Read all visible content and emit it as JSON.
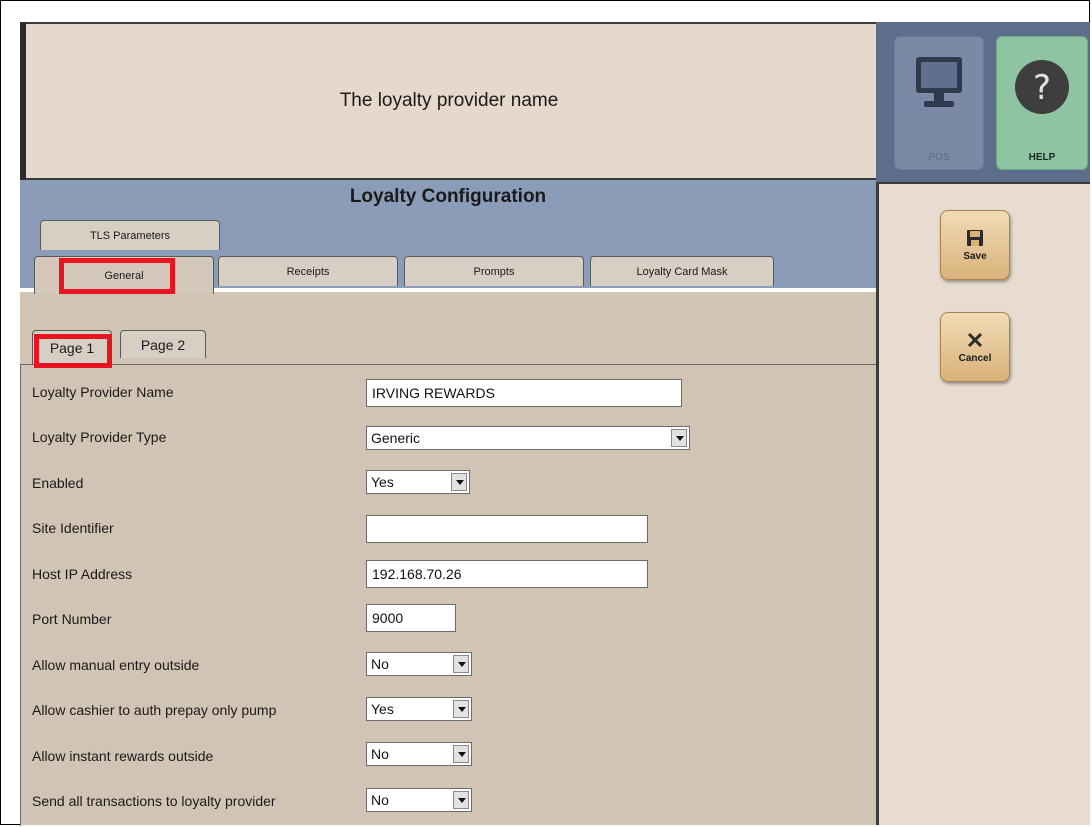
{
  "header": {
    "message": "The loyalty provider name"
  },
  "top_buttons": [
    {
      "label": "POS",
      "icon": "monitor-icon"
    },
    {
      "label": "HELP",
      "icon": "question-icon"
    }
  ],
  "title": "Loyalty Configuration",
  "tabs": {
    "tls": "TLS Parameters",
    "general": "General",
    "receipts": "Receipts",
    "prompts": "Prompts",
    "mask": "Loyalty Card Mask"
  },
  "subtabs": {
    "page1": "Page 1",
    "page2": "Page 2"
  },
  "fields": {
    "provider_name": {
      "label": "Loyalty Provider Name",
      "value": "IRVING REWARDS"
    },
    "provider_type": {
      "label": "Loyalty Provider Type",
      "value": "Generic"
    },
    "enabled": {
      "label": "Enabled",
      "value": "Yes"
    },
    "site_id": {
      "label": "Site Identifier",
      "value": ""
    },
    "host_ip": {
      "label": "Host IP Address",
      "value": "192.168.70.26"
    },
    "port": {
      "label": "Port Number",
      "value": "9000"
    },
    "manual_entry": {
      "label": "Allow manual entry outside",
      "value": "No"
    },
    "cashier_auth": {
      "label": "Allow cashier to auth prepay only pump",
      "value": "Yes"
    },
    "instant_rewards": {
      "label": "Allow instant rewards outside",
      "value": "No"
    },
    "send_all": {
      "label": "Send all transactions to loyalty provider",
      "value": "No"
    }
  },
  "actions": {
    "save": "Save",
    "cancel": "Cancel"
  },
  "colors": {
    "highlight": "#e8141f",
    "title_band": "#8b9cb8",
    "content_bg": "#d2c4b4"
  }
}
